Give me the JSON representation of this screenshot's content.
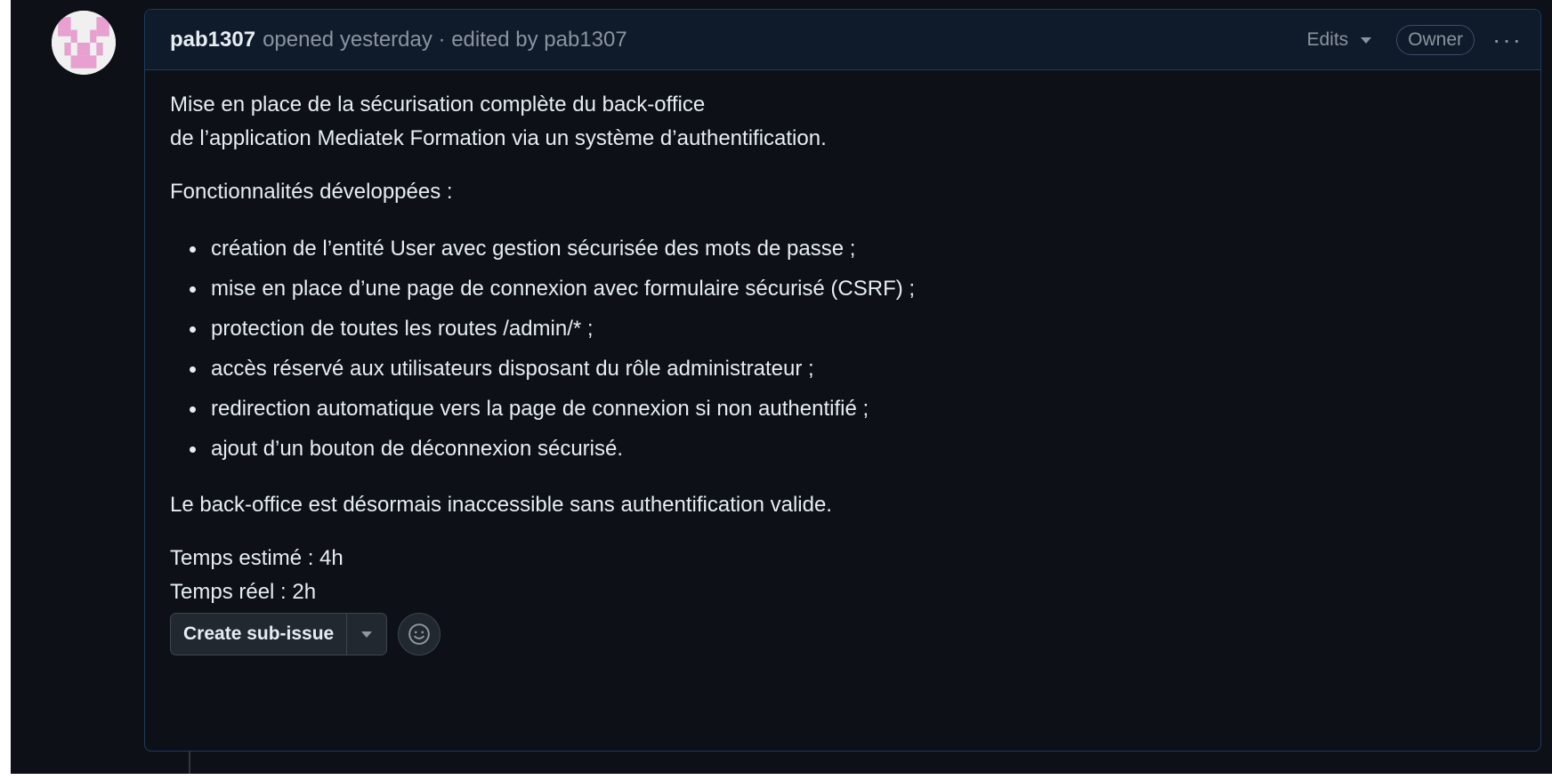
{
  "header": {
    "author": "pab1307",
    "meta": "opened yesterday · edited by pab1307",
    "edits_label": "Edits",
    "owner_badge": "Owner",
    "more_label": "···"
  },
  "body": {
    "intro_line1": "Mise en place de la sécurisation complète du back-office",
    "intro_line2": "de l’application Mediatek Formation via un système d’authentification.",
    "features_title": "Fonctionnalités développées :",
    "features": [
      "création de l’entité User avec gestion sécurisée des mots de passe ;",
      "mise en place d’une page de connexion avec formulaire sécurisé (CSRF) ;",
      "protection de toutes les routes /admin/* ;",
      "accès réservé aux utilisateurs disposant du rôle administrateur ;",
      "redirection automatique vers la page de connexion si non authentifié ;",
      "ajout d’un bouton de déconnexion sécurisé."
    ],
    "conclusion": "Le back-office est désormais inaccessible sans authentification valide.",
    "estimated_time": "Temps estimé : 4h",
    "real_time": "Temps réel : 2h"
  },
  "actions": {
    "create_sub_issue": "Create sub-issue"
  },
  "colors": {
    "background": "#0d1117",
    "border_accent": "#1f3a5f",
    "text": "#e6edf3",
    "muted": "#8b949e",
    "avatar_pink": "#e7a0cf"
  },
  "icons": {
    "avatar": "identicon-avatar",
    "edits_caret": "chevron-down-icon",
    "more": "kebab-menu-icon",
    "dropdown": "triangle-down-icon",
    "reaction": "smiley-icon"
  }
}
